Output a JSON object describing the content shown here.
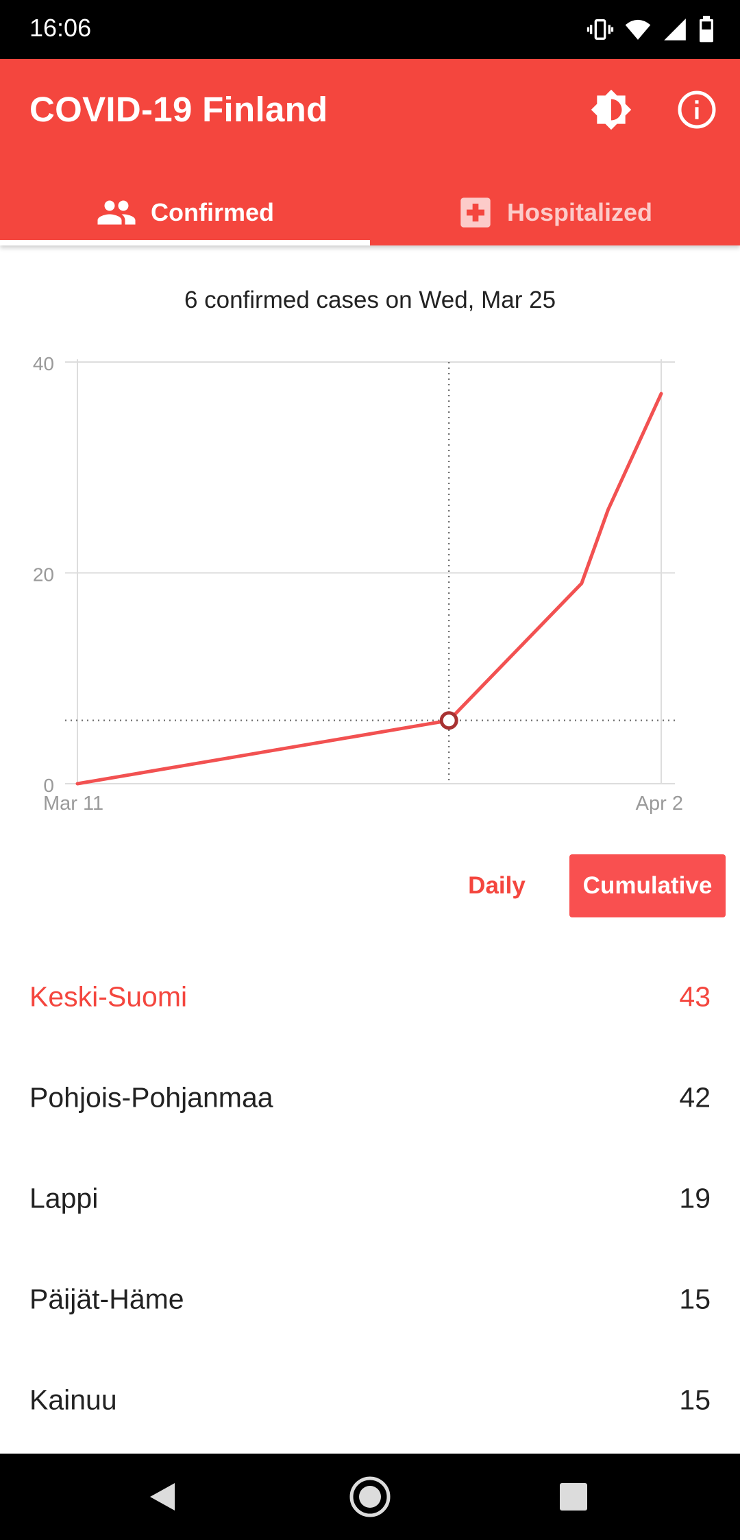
{
  "status_bar": {
    "time": "16:06"
  },
  "app_bar": {
    "title": "COVID-19 Finland"
  },
  "tabs": [
    {
      "label": "Confirmed",
      "selected": true
    },
    {
      "label": "Hospitalized",
      "selected": false
    }
  ],
  "chart_header": "6 confirmed cases on Wed, Mar 25",
  "chart_data": {
    "type": "line",
    "x": [
      "Mar 11",
      "Mar 25",
      "Mar 30",
      "Mar 31",
      "Apr 2"
    ],
    "y": [
      0,
      6,
      19,
      26,
      37
    ],
    "xlim": [
      "Mar 11",
      "Apr 2"
    ],
    "ylim": [
      0,
      40
    ],
    "y_ticks": [
      0,
      20,
      40
    ],
    "x_tick_labels": [
      "Mar 11",
      "Apr 2"
    ],
    "highlight": {
      "x": "Mar 25",
      "y": 6
    },
    "color": "#f25151",
    "grid": true
  },
  "toggle": {
    "daily_label": "Daily",
    "cumulative_label": "Cumulative",
    "selected": "Cumulative"
  },
  "regions": [
    {
      "name": "Keski-Suomi",
      "count": "43",
      "highlighted": true
    },
    {
      "name": "Pohjois-Pohjanmaa",
      "count": "42",
      "highlighted": false
    },
    {
      "name": "Lappi",
      "count": "19",
      "highlighted": false
    },
    {
      "name": "Päijät-Häme",
      "count": "15",
      "highlighted": false
    },
    {
      "name": "Kainuu",
      "count": "15",
      "highlighted": false
    }
  ],
  "colors": {
    "accent": "#f4463e",
    "line": "#f25151",
    "button": "#f95050"
  },
  "icons": {
    "status": [
      "vibrate-icon",
      "wifi-icon",
      "signal-icon",
      "battery-icon"
    ],
    "app_bar": [
      "brightness-icon",
      "info-icon"
    ],
    "tabs": [
      "people-icon",
      "hospital-icon"
    ],
    "nav": [
      "back-icon",
      "home-icon",
      "recents-icon"
    ]
  }
}
